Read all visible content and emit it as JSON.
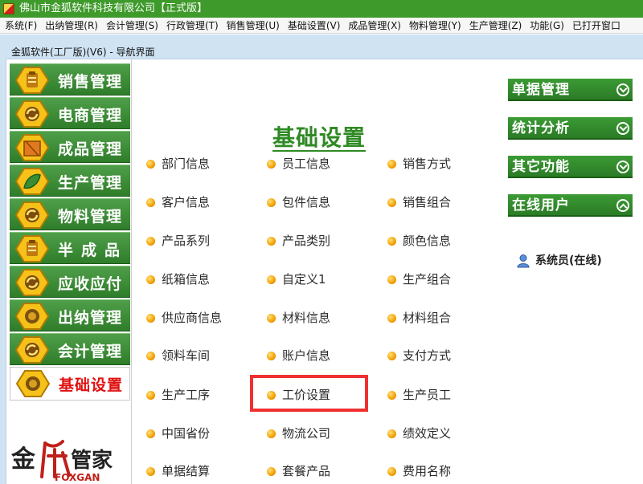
{
  "window": {
    "title": "佛山市金狐软件科技有限公司【正式版】"
  },
  "menu": [
    "系统(F)",
    "出纳管理(R)",
    "会计管理(S)",
    "行政管理(T)",
    "销售管理(U)",
    "基础设置(V)",
    "成品管理(X)",
    "物料管理(Y)",
    "生产管理(Z)",
    "功能(G)",
    "已打开窗口"
  ],
  "frame": {
    "title": "金狐软件(工厂版)(V6) - 导航界面"
  },
  "leftnav": {
    "items": [
      "销售管理",
      "电商管理",
      "成品管理",
      "生产管理",
      "物料管理",
      "半成品",
      "应收应付",
      "出纳管理",
      "会计管理",
      "基础设置"
    ],
    "active": "基础设置"
  },
  "logo": {
    "text_left": "金",
    "text_right": "管家",
    "brand": "FOXGAN"
  },
  "main": {
    "heading": "基础设置",
    "links": [
      [
        "部门信息",
        "员工信息",
        "销售方式"
      ],
      [
        "客户信息",
        "包件信息",
        "销售组合"
      ],
      [
        "产品系列",
        "产品类别",
        "颜色信息"
      ],
      [
        "纸箱信息",
        "自定义1",
        "生产组合"
      ],
      [
        "供应商信息",
        "材料信息",
        "材料组合"
      ],
      [
        "领料车间",
        "账户信息",
        "支付方式"
      ],
      [
        "生产工序",
        "工价设置",
        "生产员工"
      ],
      [
        "中国省份",
        "物流公司",
        "绩效定义"
      ],
      [
        "单据结算",
        "套餐产品",
        "费用名称"
      ]
    ],
    "highlighted": "工价设置"
  },
  "rightpanel": {
    "sections": [
      "单据管理",
      "统计分析",
      "其它功能",
      "在线用户"
    ],
    "online_user": "系统员(在线)"
  },
  "colors": {
    "titlebar": "#3e9a2a",
    "nav_green": "#3a8d35",
    "highlight": "#f03030",
    "heading": "#2f8a24"
  }
}
